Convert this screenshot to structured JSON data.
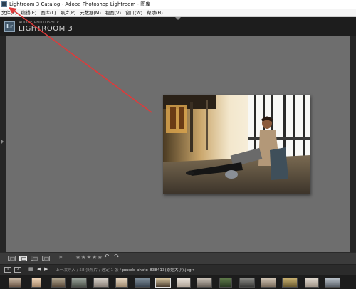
{
  "window": {
    "title": "Lightroom 3 Catalog - Adobe Photoshop Lightroom - 图库"
  },
  "menu": {
    "items": [
      "文件(F)",
      "编辑(E)",
      "图库(L)",
      "照片(P)",
      "元数据(M)",
      "视图(V)",
      "窗口(W)",
      "帮助(H)"
    ]
  },
  "identity": {
    "badge": "Lr",
    "vendor": "ADOBE PHOTOSHOP",
    "product": "LIGHTROOM 3"
  },
  "toolbar": {
    "stars": "★★★★★",
    "rating": 0
  },
  "filmstrip": {
    "page1": "1",
    "page2": "2",
    "path_prefix": "上一次导入 / 58 张照片 / 选定 1 张 /",
    "path_file": "pexels-photo-838413(原始大小).jpg",
    "path_suffix": "▾",
    "thumb_count": 16
  },
  "colors": {
    "main_bg": "#6e6e6e",
    "panel_dark": "#1d1d1d",
    "annotation": "#e03a3a"
  }
}
